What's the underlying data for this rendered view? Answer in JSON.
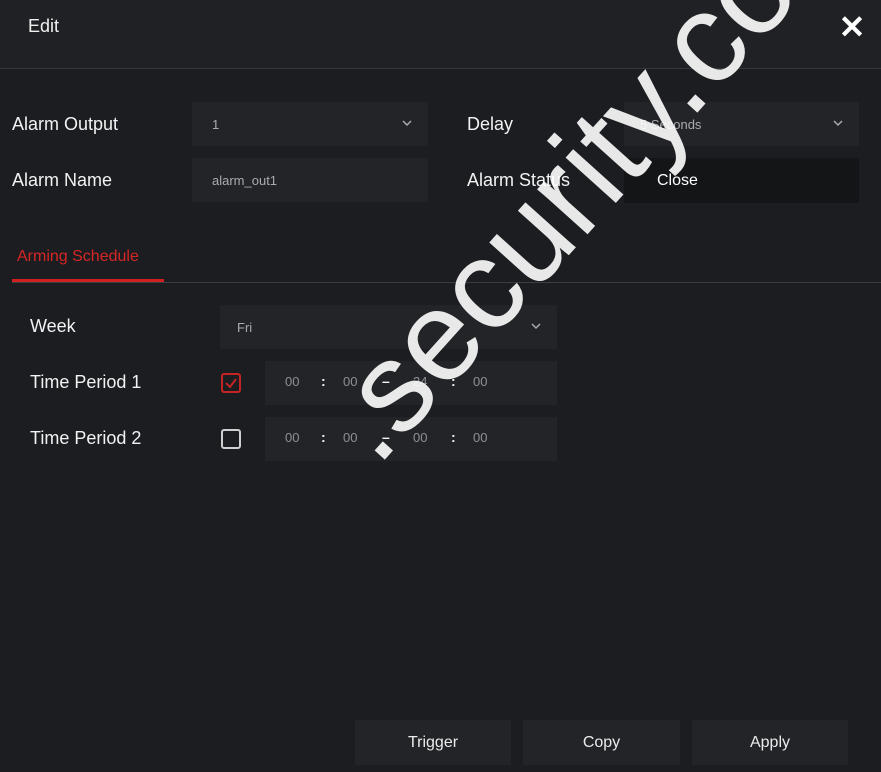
{
  "dialog": {
    "title": "Edit"
  },
  "alarm_output": {
    "label": "Alarm Output",
    "value": "1"
  },
  "delay": {
    "label": "Delay",
    "value": "5 Seconds"
  },
  "alarm_name": {
    "label": "Alarm Name",
    "value": "alarm_out1"
  },
  "alarm_status": {
    "label": "Alarm Status",
    "value": "Close"
  },
  "tabs": [
    {
      "label": "Arming Schedule",
      "active": true
    }
  ],
  "week": {
    "label": "Week",
    "value": "Fri"
  },
  "time_periods": [
    {
      "label": "Time Period 1",
      "checked": true,
      "start_h": "00",
      "start_m": "00",
      "end_h": "24",
      "end_m": "00"
    },
    {
      "label": "Time Period 2",
      "checked": false,
      "start_h": "00",
      "start_m": "00",
      "end_h": "00",
      "end_m": "00"
    }
  ],
  "time_separators": {
    "colon": ":",
    "dash": "–"
  },
  "footer": {
    "trigger": "Trigger",
    "copy": "Copy",
    "apply": "Apply"
  },
  "watermark": ".security.co",
  "colors": {
    "accent": "#d01f1f",
    "background": "#1b1d20",
    "field": "#222427"
  }
}
